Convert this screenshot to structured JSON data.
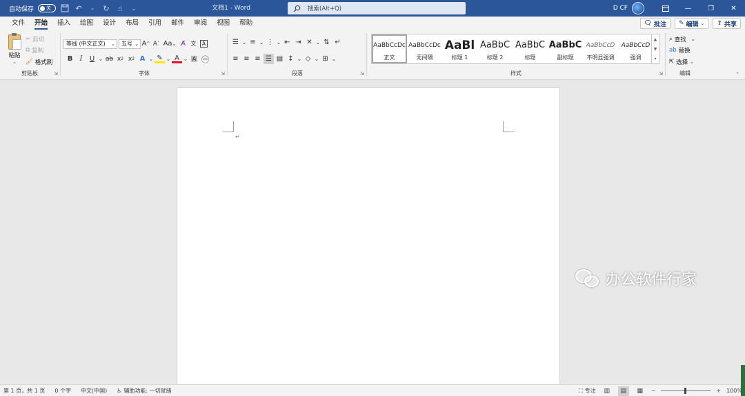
{
  "titlebar": {
    "autosave_label": "自动保存",
    "autosave_state": "关",
    "doc_title": "文档1  -  Word",
    "search_placeholder": "搜索(Alt+Q)",
    "user_name": "D CF"
  },
  "tabs": [
    "文件",
    "开始",
    "插入",
    "绘图",
    "设计",
    "布局",
    "引用",
    "邮件",
    "审阅",
    "视图",
    "帮助"
  ],
  "active_tab": "开始",
  "tab_actions": {
    "comments_label": "批注",
    "editing_label": "编辑",
    "share_label": "共享"
  },
  "ribbon": {
    "clipboard": {
      "paste_label": "粘贴",
      "cut_label": "剪切",
      "copy_label": "复制",
      "format_painter_label": "格式刷",
      "group_label": "剪贴板"
    },
    "font": {
      "font_name": "等线 (中文正文)",
      "font_size": "五号",
      "change_case": "Aa",
      "group_label": "字体"
    },
    "paragraph": {
      "group_label": "段落"
    },
    "styles": {
      "group_label": "样式",
      "items": [
        {
          "preview": "AaBbCcDc",
          "name": "正文"
        },
        {
          "preview": "AaBbCcDc",
          "name": "无间隔"
        },
        {
          "preview": "AaBl",
          "name": "标题 1"
        },
        {
          "preview": "AaBbC",
          "name": "标题 2"
        },
        {
          "preview": "AaBbC",
          "name": "标题"
        },
        {
          "preview": "AaBbC",
          "name": "副标题"
        },
        {
          "preview": "AaBbCcD",
          "name": "不明显强调"
        },
        {
          "preview": "AaBbCcD",
          "name": "强调"
        }
      ]
    },
    "editing": {
      "find_label": "查找",
      "replace_label": "替换",
      "select_label": "选择",
      "group_label": "编辑"
    }
  },
  "watermark": {
    "text": "办公软件行家"
  },
  "statusbar": {
    "page_info": "第 1 页，共 1 页",
    "word_count": "0 个字",
    "language": "中文(中国)",
    "accessibility": "辅助功能: 一切就绪",
    "focus_label": "专注",
    "zoom": "100%"
  },
  "colors": {
    "titlebar_bg": "#2b579a",
    "font_color_bar": "#e81123",
    "highlight_bar": "#ffe600"
  }
}
